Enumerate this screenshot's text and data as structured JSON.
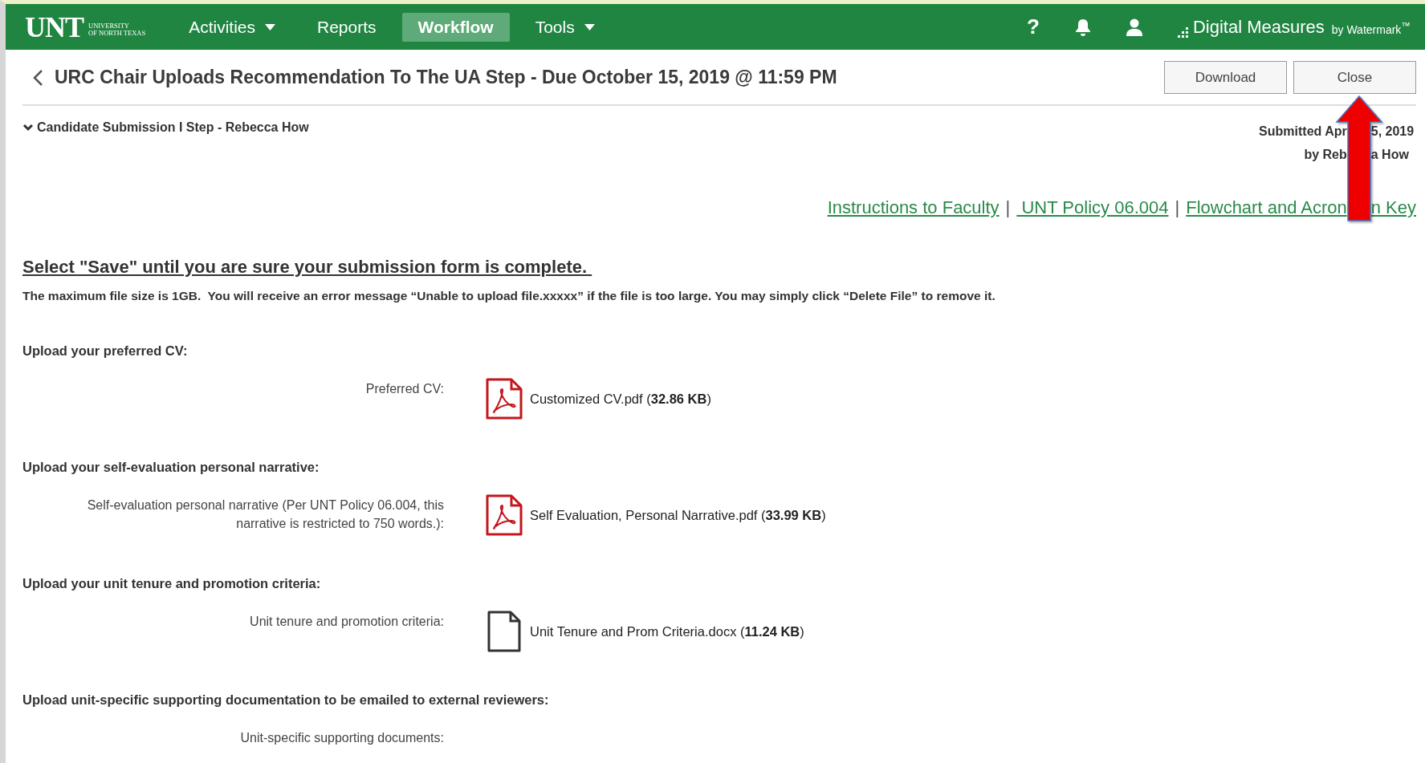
{
  "nav": {
    "logo": {
      "wordmark": "UNT",
      "subtitle_lines": [
        "UNIVERSITY",
        "OF NORTH TEXAS"
      ]
    },
    "items": [
      {
        "label": "Activities",
        "has_menu": true,
        "selected": false
      },
      {
        "label": "Reports",
        "has_menu": false,
        "selected": false
      },
      {
        "label": "Workflow",
        "has_menu": false,
        "selected": true
      },
      {
        "label": "Tools",
        "has_menu": true,
        "selected": false
      }
    ],
    "help": "?",
    "brand": {
      "name": "Digital Measures",
      "byline": "by Watermark$^{™}$"
    }
  },
  "header": {
    "title": "URC Chair Uploads Recommendation To The UA Step - Due October 15, 2019 @ 11:59 PM",
    "buttons": [
      "Download",
      "Close"
    ]
  },
  "step": {
    "title": "Candidate Submission I Step - Rebecca How",
    "expanded": true,
    "submitted_lines": [
      [
        "Submitted Apr",
        "5, 2019"
      ],
      [
        "by Reb",
        "a How"
      ]
    ]
  },
  "links": [
    {
      "kind": "link",
      "parts": [
        "Instructions to Faculty"
      ]
    },
    {
      "kind": "separator",
      "parts": [
        "|"
      ]
    },
    {
      "kind": "link",
      "parts": [
        " UNT Policy 06.004"
      ]
    },
    {
      "kind": "separator",
      "parts": [
        "|"
      ]
    },
    {
      "kind": "link",
      "parts": [
        "Flowchart and Acron",
        "n Key"
      ]
    }
  ],
  "notice": {
    "heading": "Select \"Save\" until you are sure your submission form is complete. ",
    "text": "The maximum file size is 1GB.  You will receive an error message “Unable to upload file.xxxxx” if the file is too large. You may simply click “Delete File” to remove it."
  },
  "sections": [
    {
      "heading": "Upload your preferred CV:",
      "label": "Preferred CV:",
      "file": {
        "kind": "pdf",
        "text": "Customized CV.pdf (**32.86 KB**)"
      }
    },
    {
      "heading": "Upload your self-evaluation personal narrative:",
      "label": "Self-evaluation personal narrative (Per UNT Policy 06.004, this narrative is restricted to 750 words.):",
      "file": {
        "kind": "pdf",
        "text": "Self Evaluation, Personal Narrative.pdf (**33.99 KB**)"
      }
    },
    {
      "heading": "Upload your unit tenure and promotion criteria:",
      "label": "Unit tenure and promotion criteria:",
      "file": {
        "kind": "doc",
        "text": "Unit Tenure and Prom Criteria.docx (**11.24 KB**)"
      }
    },
    {
      "heading": "Upload unit-specific supporting documentation to be emailed to external reviewers:",
      "label": "Unit-specific supporting documents:"
    }
  ]
}
